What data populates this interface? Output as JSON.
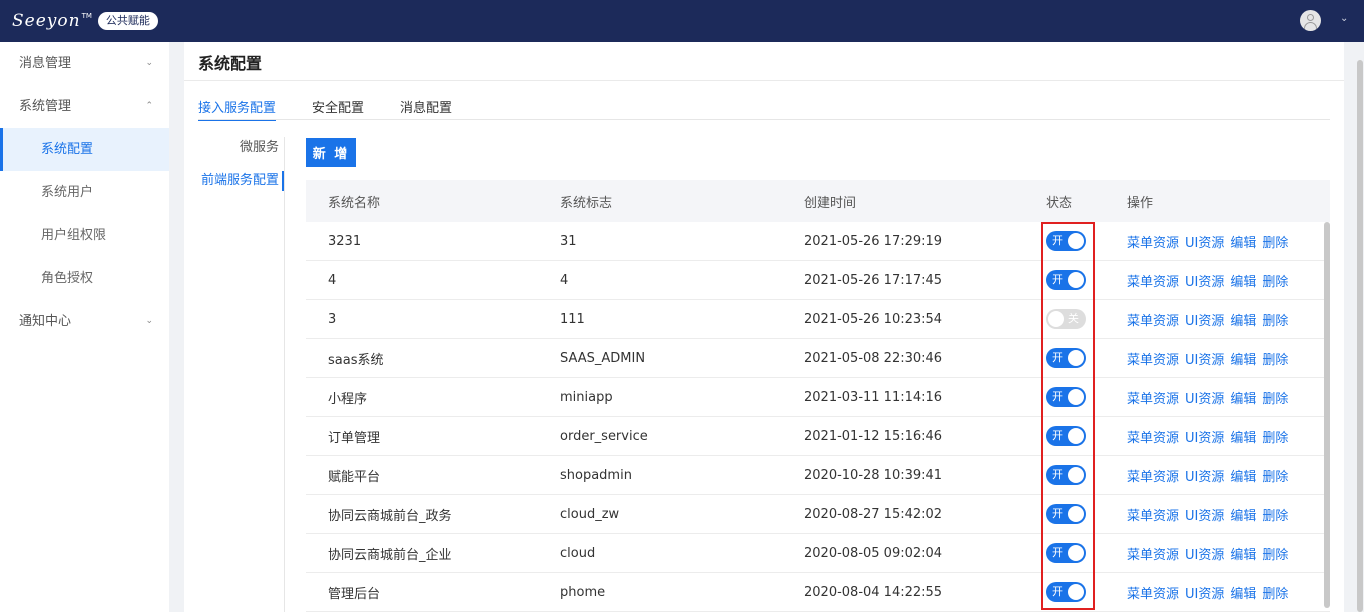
{
  "header": {
    "logo_text": "Seeyon",
    "logo_tm": "TM",
    "logo_badge": "公共赋能",
    "caret": "⌄"
  },
  "sidebar": {
    "groups": [
      {
        "label": "消息管理",
        "arrow": "⌄"
      },
      {
        "label": "系统管理",
        "arrow": "⌃"
      },
      {
        "label": "通知中心",
        "arrow": "⌄"
      }
    ],
    "items": [
      {
        "label": "系统配置",
        "active": true
      },
      {
        "label": "系统用户",
        "active": false
      },
      {
        "label": "用户组权限",
        "active": false
      },
      {
        "label": "角色授权",
        "active": false
      }
    ]
  },
  "page": {
    "title": "系统配置",
    "tabs": [
      "接入服务配置",
      "安全配置",
      "消息配置"
    ],
    "subnav": [
      "微服务",
      "前端服务配置"
    ],
    "add_button": "新 增"
  },
  "table": {
    "columns": [
      "系统名称",
      "系统标志",
      "创建时间",
      "状态",
      "操作"
    ],
    "on_label": "开",
    "off_label": "关",
    "actions": [
      "菜单资源",
      "UI资源",
      "编辑",
      "删除"
    ],
    "rows": [
      {
        "name": "3231",
        "code": "31",
        "created": "2021-05-26 17:29:19",
        "enabled": true
      },
      {
        "name": "4",
        "code": "4",
        "created": "2021-05-26 17:17:45",
        "enabled": true
      },
      {
        "name": "3",
        "code": "111",
        "created": "2021-05-26 10:23:54",
        "enabled": false
      },
      {
        "name": "saas系统",
        "code": "SAAS_ADMIN",
        "created": "2021-05-08 22:30:46",
        "enabled": true
      },
      {
        "name": "小程序",
        "code": "miniapp",
        "created": "2021-03-11 11:14:16",
        "enabled": true
      },
      {
        "name": "订单管理",
        "code": "order_service",
        "created": "2021-01-12 15:16:46",
        "enabled": true
      },
      {
        "name": "赋能平台",
        "code": "shopadmin",
        "created": "2020-10-28 10:39:41",
        "enabled": true
      },
      {
        "name": "协同云商城前台_政务",
        "code": "cloud_zw",
        "created": "2020-08-27 15:42:02",
        "enabled": true
      },
      {
        "name": "协同云商城前台_企业",
        "code": "cloud",
        "created": "2020-08-05 09:02:04",
        "enabled": true
      },
      {
        "name": "管理后台",
        "code": "phome",
        "created": "2020-08-04 14:22:55",
        "enabled": true
      }
    ]
  },
  "colors": {
    "topbar": "#1c2a5a",
    "accent": "#1a73e8",
    "highlight": "#e02020"
  }
}
